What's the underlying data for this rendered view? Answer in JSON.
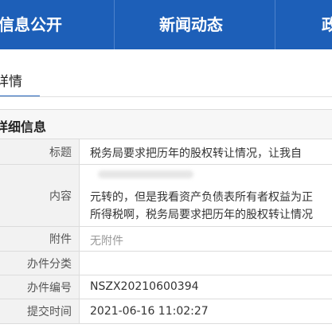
{
  "nav": {
    "items": [
      "信息公开",
      "新闻动态",
      "政"
    ]
  },
  "tab": {
    "label": "详情"
  },
  "section": {
    "title": "详细信息"
  },
  "details": {
    "title_label": "标题",
    "title_value": "税务局要求把历年的股权转让情况，让我自",
    "content_label": "内容",
    "content_line1": "元转的，但是我看资产负债表所有者权益为正",
    "content_line2": "所得税啊，税务局要求把历年的股权转让情况",
    "attachment_label": "附件",
    "attachment_value": "无附件",
    "category_label": "办件分类",
    "category_value": "",
    "number_label": "办件编号",
    "number_value": "NSZX20210600394",
    "time_label": "提交时间",
    "time_value": "2021-06-16 11:02:27"
  }
}
